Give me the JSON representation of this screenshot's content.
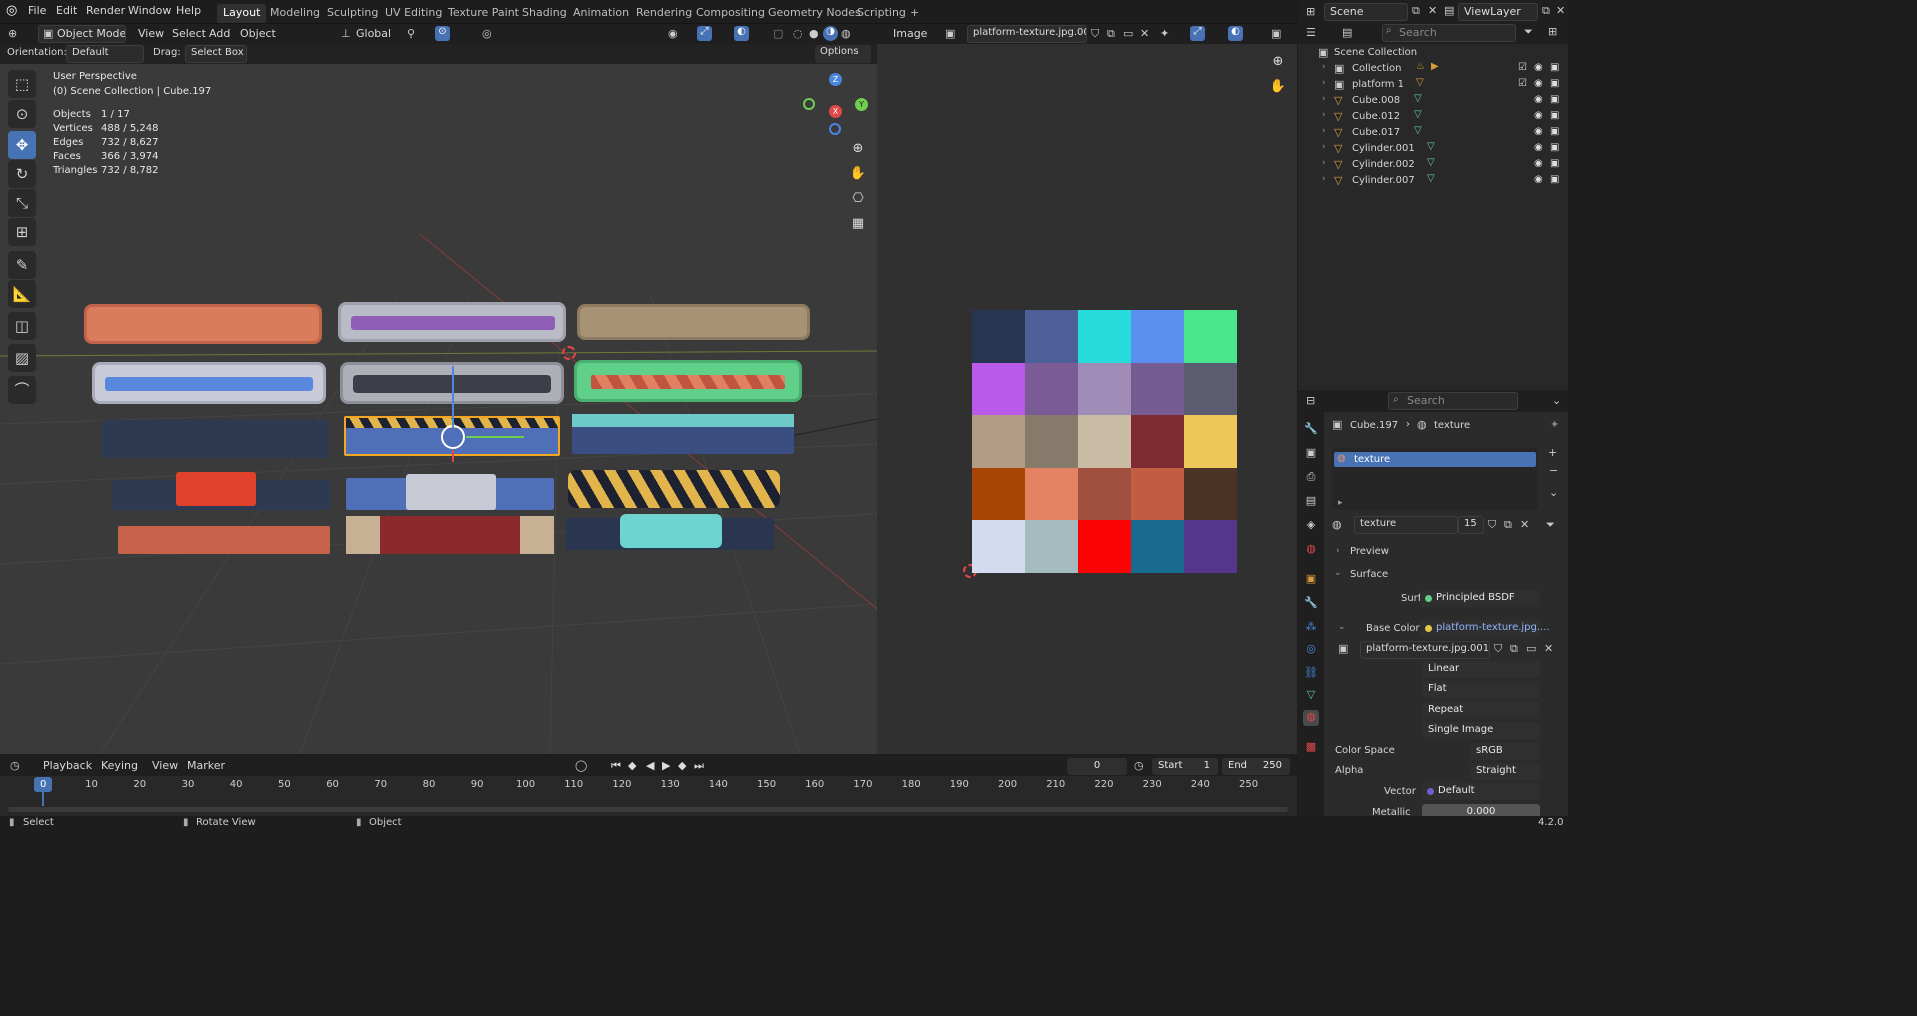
{
  "topbar": {
    "menus": [
      "File",
      "Edit",
      "Render",
      "Window",
      "Help"
    ],
    "workspaces": [
      "Layout",
      "Modeling",
      "Sculpting",
      "UV Editing",
      "Texture Paint",
      "Shading",
      "Animation",
      "Rendering",
      "Compositing",
      "Geometry Nodes",
      "Scripting"
    ],
    "active_workspace": "Layout",
    "add_tab": "+",
    "scene": "Scene",
    "view_layer": "ViewLayer"
  },
  "viewport_header": {
    "mode": "Object Mode",
    "menus": [
      "View",
      "Select",
      "Add",
      "Object"
    ],
    "transform": "Global",
    "orientation_label": "Orientation:",
    "orientation_value": "Default",
    "drag_label": "Drag:",
    "drag_value": "Select Box",
    "options": "Options"
  },
  "viewport_overlay": {
    "perspective": "User Perspective",
    "collection_path": "(0) Scene Collection | Cube.197",
    "stats": [
      {
        "label": "Objects",
        "value": "1 / 17"
      },
      {
        "label": "Vertices",
        "value": "488 / 5,248"
      },
      {
        "label": "Edges",
        "value": "732 / 8,627"
      },
      {
        "label": "Faces",
        "value": "366 / 3,974"
      },
      {
        "label": "Triangles",
        "value": "732 / 8,782"
      }
    ],
    "gizmo": {
      "z": "Z",
      "y": "Y",
      "x": "X"
    }
  },
  "image_editor": {
    "menu": "Image",
    "image_name": "platform-texture.jpg.001",
    "texture_colors": [
      [
        "#263550",
        "#4d5f97",
        "#28dbdb",
        "#5a8fef",
        "#4ae68c"
      ],
      [
        "#b95aeb",
        "#7a5b96",
        "#9f8db8",
        "#755c93",
        "#5c5c70"
      ],
      [
        "#b39c86",
        "#867a6b",
        "#c9bba4",
        "#7e2a30",
        "#edc757"
      ],
      [
        "#a84405",
        "#e38364",
        "#a1503f",
        "#c25d44",
        "#4b3426"
      ],
      [
        "#d3dbef",
        "#a4bcbf",
        "#fa0303",
        "#186a8f",
        "#54368c"
      ]
    ]
  },
  "outliner": {
    "search_placeholder": "Search",
    "root": "Scene Collection",
    "items": [
      "Collection",
      "platform 1",
      "Cube.008",
      "Cube.012",
      "Cube.017",
      "Cylinder.001",
      "Cylinder.002",
      "Cylinder.007"
    ]
  },
  "properties": {
    "search_placeholder": "Search",
    "breadcrumb_object": "Cube.197",
    "breadcrumb_material": "texture",
    "slot_name": "texture",
    "material_name": "texture",
    "user_count": "15",
    "preview": "Preview",
    "surface_panel": "Surface",
    "surface_label": "Surface",
    "surface_value": "Principled BSDF",
    "base_color_label": "Base Color",
    "base_color_value": "platform-texture.jpg....",
    "image_datablock": "platform-texture.jpg.001",
    "interpolation": "Linear",
    "projection": "Flat",
    "extension": "Repeat",
    "source": "Single Image",
    "color_space_label": "Color Space",
    "color_space_value": "sRGB",
    "alpha_label": "Alpha",
    "alpha_value": "Straight",
    "vector_label": "Vector",
    "vector_value": "Default",
    "metallic_label": "Metallic",
    "metallic_value": "0.000"
  },
  "timeline": {
    "menus": [
      "Playback",
      "Keying",
      "View",
      "Marker"
    ],
    "current_frame": "0",
    "start_label": "Start",
    "start_value": "1",
    "end_label": "End",
    "end_value": "250",
    "ticks": [
      "0",
      "10",
      "20",
      "30",
      "40",
      "50",
      "60",
      "70",
      "80",
      "90",
      "100",
      "110",
      "120",
      "130",
      "140",
      "150",
      "160",
      "170",
      "180",
      "190",
      "200",
      "210",
      "220",
      "230",
      "240",
      "250"
    ]
  },
  "statusbar": {
    "select": "Select",
    "rotate": "Rotate View",
    "object": "Object",
    "version": "4.2.0"
  },
  "colors": {
    "accent": "#4772b3",
    "selected_outline": "#f5a623",
    "icon_orange": "#d89b3c",
    "icon_green": "#5fcf8a"
  }
}
